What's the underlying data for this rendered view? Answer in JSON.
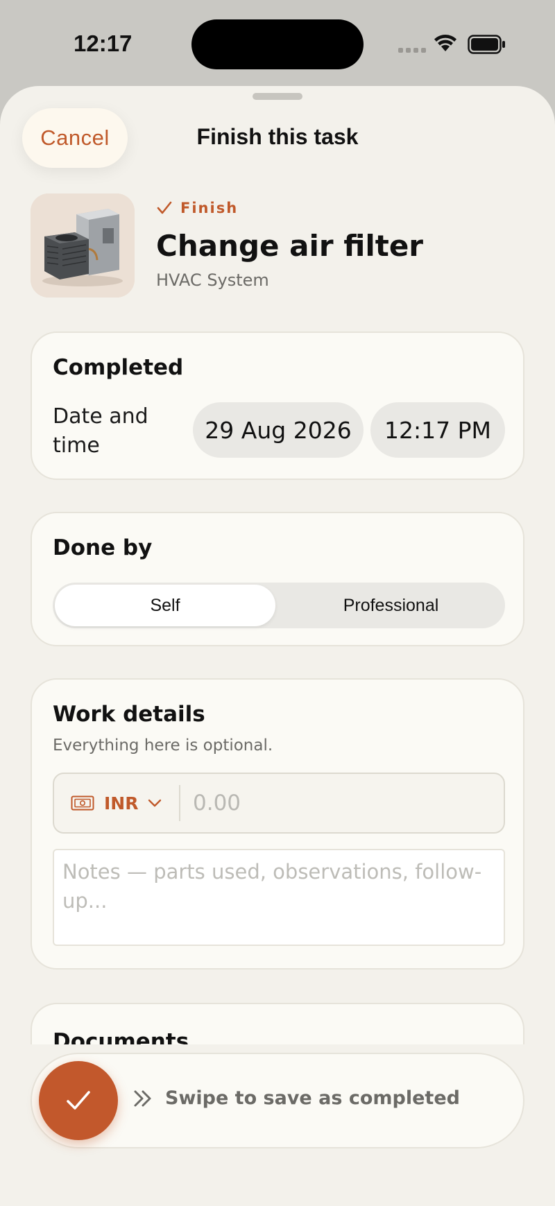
{
  "status_bar": {
    "time": "12:17"
  },
  "sheet": {
    "cancel_label": "Cancel",
    "title": "Finish this task"
  },
  "task": {
    "tag": "Finish",
    "name": "Change air filter",
    "category": "HVAC System"
  },
  "completed": {
    "title": "Completed",
    "date_label": "Date and time",
    "date": "29 Aug 2026",
    "time": "12:17 PM"
  },
  "done_by": {
    "title": "Done by",
    "options": [
      "Self",
      "Professional"
    ],
    "selected": "Self"
  },
  "work_details": {
    "title": "Work details",
    "subtitle": "Everything here is optional.",
    "currency": "INR",
    "amount_placeholder": "0.00",
    "notes_placeholder": "Notes — parts used, observations, follow-up..."
  },
  "documents": {
    "title": "Documents"
  },
  "swipe": {
    "label": "Swipe to save as completed"
  },
  "colors": {
    "accent": "#c0592a",
    "background": "#f3f1eb",
    "card": "#fbfaf5"
  },
  "icons": {
    "check": "checkmark-icon",
    "currency": "banknote-icon",
    "dropdown": "chevron-down-icon",
    "swipe_hint": "double-chevron-right-icon"
  }
}
